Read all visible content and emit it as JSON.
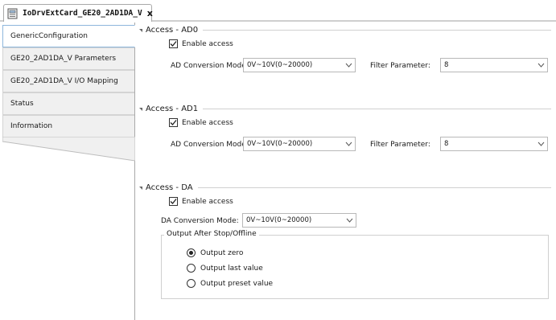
{
  "tab": {
    "title": "IoDrvExtCard_GE20_2AD1DA_V",
    "close_glyph": "x",
    "icon": "card-icon"
  },
  "nav": {
    "items": [
      {
        "label": "GenericConfiguration",
        "active": true
      },
      {
        "label": "GE20_2AD1DA_V Parameters",
        "active": false
      },
      {
        "label": "GE20_2AD1DA_V I/O Mapping",
        "active": false
      },
      {
        "label": "Status",
        "active": false
      },
      {
        "label": "Information",
        "active": false
      }
    ]
  },
  "ad0": {
    "title": "Access - AD0",
    "enable_label": "Enable access",
    "enabled": true,
    "mode_label": "AD Conversion Mode:",
    "mode_value": "0V~10V(0~20000)",
    "filter_label": "Filter Parameter:",
    "filter_value": "8"
  },
  "ad1": {
    "title": "Access - AD1",
    "enable_label": "Enable access",
    "enabled": true,
    "mode_label": "AD Conversion Mode:",
    "mode_value": "0V~10V(0~20000)",
    "filter_label": "Filter Parameter:",
    "filter_value": "8"
  },
  "da": {
    "title": "Access - DA",
    "enable_label": "Enable access",
    "enabled": true,
    "mode_label": "DA Conversion Mode:",
    "mode_value": "0V~10V(0~20000)",
    "output_group_label": "Output After Stop/Offline",
    "options": [
      {
        "label": "Output zero",
        "selected": true
      },
      {
        "label": "Output last value",
        "selected": false
      },
      {
        "label": "Output preset value",
        "selected": false
      }
    ]
  },
  "colors": {
    "active_border": "#8eb6dc",
    "nav_bg": "#f0f0f0",
    "rule": "#d0d0d0"
  }
}
